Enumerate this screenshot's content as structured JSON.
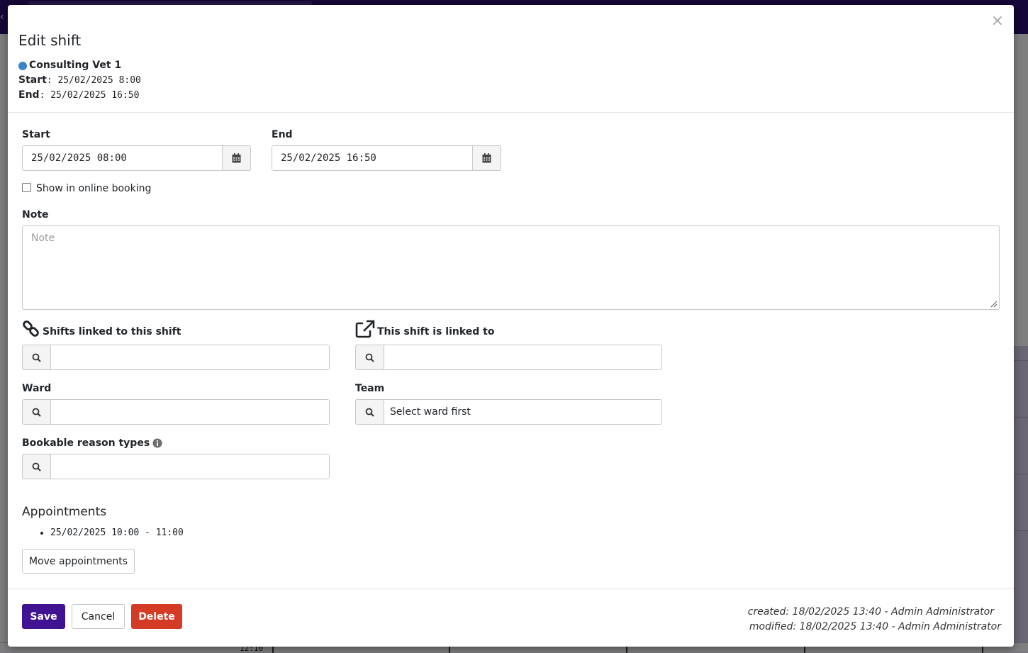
{
  "modal": {
    "title": "Edit shift",
    "close_glyph": "×",
    "resource_name": "Consulting Vet 1",
    "resource_color": "#3a83c4",
    "summary_start_label": "Start",
    "summary_start_value": ": 25/02/2025 8:00",
    "summary_end_label": "End",
    "summary_end_value": ": 25/02/2025 16:50"
  },
  "form": {
    "start": {
      "label": "Start",
      "value": "25/02/2025 08:00",
      "icon": "calendar-icon"
    },
    "end": {
      "label": "End",
      "value": "25/02/2025 16:50",
      "icon": "calendar-icon"
    },
    "online_booking": {
      "label": "Show in online booking",
      "checked": false
    },
    "note": {
      "label": "Note",
      "placeholder": "Note",
      "value": ""
    },
    "linked_shifts": {
      "label": "Shifts linked to this shift",
      "icon": "link-icon",
      "value": ""
    },
    "linked_to": {
      "label": "This shift is linked to",
      "icon": "external-link-icon",
      "value": ""
    },
    "ward": {
      "label": "Ward",
      "value": ""
    },
    "team": {
      "label": "Team",
      "value": "Select ward first"
    },
    "reason_types": {
      "label": "Bookable reason types",
      "icon": "info-icon",
      "value": ""
    }
  },
  "appointments": {
    "title": "Appointments",
    "items": [
      "25/02/2025 10:00 - 11:00"
    ],
    "move_button": "Move appointments"
  },
  "footer": {
    "save": "Save",
    "cancel": "Cancel",
    "delete": "Delete",
    "created": "created: 18/02/2025 13:40 - Admin Administrator",
    "modified": "modified: 18/02/2025 13:40 - Admin Administrator"
  },
  "background": {
    "time_label": "12:10"
  },
  "colors": {
    "primary": "#3f1391",
    "danger": "#d43b25",
    "topbar": "#2a0f6e"
  }
}
